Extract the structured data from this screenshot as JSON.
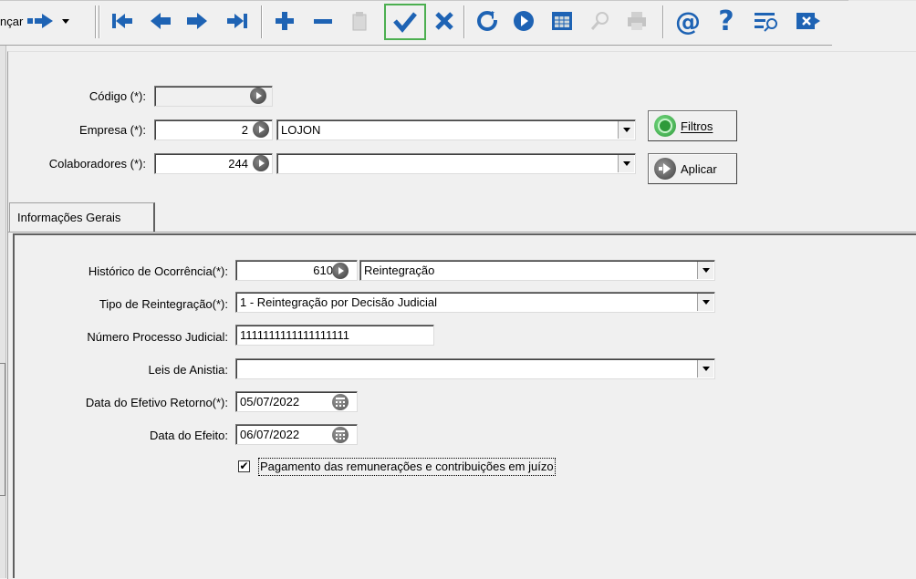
{
  "toolbar": {
    "advance_label": "nçar",
    "icons": [
      "arrow-right-icon",
      "dropdown-arrow-icon",
      "first-record-icon",
      "prev-record-icon",
      "next-record-icon",
      "last-record-icon",
      "add-icon",
      "remove-icon",
      "clipboard-icon",
      "check-icon",
      "cancel-icon",
      "refresh-icon",
      "go-icon",
      "grid-icon",
      "search-icon",
      "print-icon",
      "at-icon",
      "help-icon",
      "filter-list-icon",
      "exit-icon"
    ]
  },
  "header": {
    "codigo_label": "Código (*):",
    "codigo_value": "",
    "empresa_label": "Empresa (*):",
    "empresa_code": "2",
    "empresa_name": "LOJON",
    "colaboradores_label": "Colaboradores (*):",
    "colaboradores_code": "244",
    "colaboradores_name": "",
    "filtros_label": "Filtros",
    "aplicar_label": "Aplicar"
  },
  "tabs": [
    {
      "label": "Informações Gerais",
      "active": true
    }
  ],
  "form": {
    "historico_label": "Histórico de Ocorrência(*):",
    "historico_code": "610",
    "historico_name": "Reintegração",
    "tipo_label": "Tipo de Reintegração(*):",
    "tipo_value": "1 - Reintegração por Decisão Judicial",
    "processo_label": "Número Processo Judicial:",
    "processo_value": "1111111111111111111",
    "leis_label": "Leis de Anistia:",
    "leis_value": "",
    "retorno_label": "Data do Efetivo Retorno(*):",
    "retorno_value": "05/07/2022",
    "efeito_label": "Data do Efeito:",
    "efeito_value": "06/07/2022",
    "pagamento_label": "Pagamento das remunerações e contribuições em juízo",
    "pagamento_checked": true,
    "check_mark": "✔"
  },
  "colors": {
    "check_highlight": "#4caf50",
    "toolbar_blue": "#1e63b4",
    "toolbar_red": "#c62828",
    "filtros_green": "#2e9a3a"
  }
}
